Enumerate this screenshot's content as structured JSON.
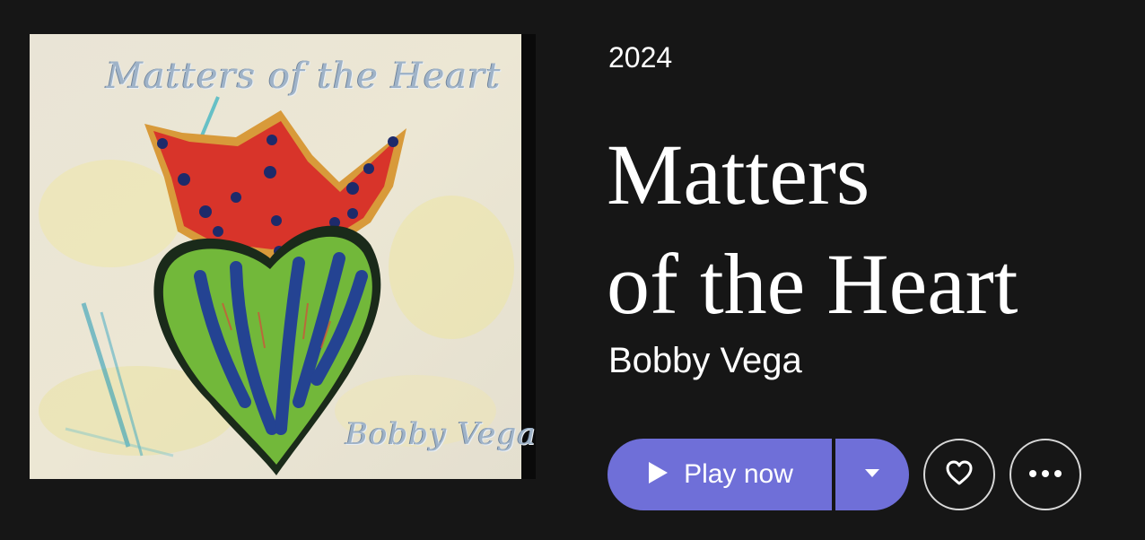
{
  "album": {
    "cover_title": "Matters of the Heart",
    "cover_artist": "Bobby Vega",
    "year": "2024",
    "title_line1": "Matters",
    "title_line2": "of the Heart",
    "artist": "Bobby Vega"
  },
  "actions": {
    "play_label": "Play now",
    "play_icon": "play-triangle-icon",
    "dropdown_icon": "caret-down-icon",
    "favorite_icon": "heart-outline-icon",
    "more_icon": "ellipsis-icon"
  },
  "colors": {
    "background": "#161616",
    "accent": "#6f6fd8",
    "text": "#ffffff",
    "outline": "#d8d8d8"
  }
}
